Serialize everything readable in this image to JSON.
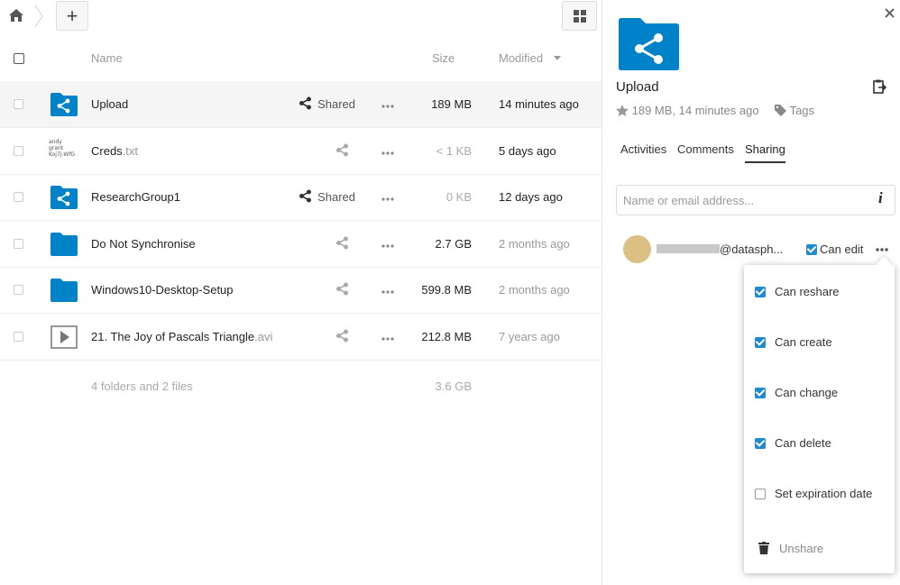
{
  "toolbar": {
    "new_label": "+"
  },
  "header": {
    "name": "Name",
    "size": "Size",
    "modified": "Modified"
  },
  "files": [
    {
      "name": "Upload",
      "ext": "",
      "type": "shared-folder",
      "share_label": "Shared",
      "size": "189 MB",
      "modified": "14 minutes ago",
      "selected": true,
      "size_color": "#222",
      "mod_color": "#222"
    },
    {
      "name": "Creds",
      "ext": ".txt",
      "type": "text",
      "thumb_text": "andy grant Koj7j-WfG",
      "share_label": "",
      "size": "< 1 KB",
      "modified": "5 days ago",
      "selected": false,
      "size_color": "#aaa",
      "mod_color": "#222"
    },
    {
      "name": "ResearchGroup1",
      "ext": "",
      "type": "shared-folder",
      "share_label": "Shared",
      "size": "0 KB",
      "modified": "12 days ago",
      "selected": false,
      "size_color": "#aaa",
      "mod_color": "#222"
    },
    {
      "name": "Do Not Synchronise",
      "ext": "",
      "type": "folder",
      "share_label": "",
      "size": "2.7 GB",
      "modified": "2 months ago",
      "selected": false,
      "size_color": "#222",
      "mod_color": "#999"
    },
    {
      "name": "Windows10-Desktop-Setup",
      "ext": "",
      "type": "folder",
      "share_label": "",
      "size": "599.8 MB",
      "modified": "2 months ago",
      "selected": false,
      "size_color": "#222",
      "mod_color": "#999"
    },
    {
      "name": "21. The Joy of Pascals Triangle",
      "ext": ".avi",
      "type": "video",
      "share_label": "",
      "size": "212.8 MB",
      "modified": "7 years ago",
      "selected": false,
      "size_color": "#222",
      "mod_color": "#999"
    }
  ],
  "summary": {
    "count": "4 folders and 2 files",
    "total": "3.6 GB"
  },
  "sidebar": {
    "title": "Upload",
    "meta": "189 MB, 14 minutes ago",
    "tags_label": "Tags",
    "tabs": [
      "Activities",
      "Comments",
      "Sharing"
    ],
    "active_tab": 2,
    "share_placeholder": "Name or email address...",
    "share_entry": {
      "email": "@datasph...",
      "permission_label": "Can edit"
    },
    "menu": {
      "items": [
        {
          "label": "Can reshare",
          "checked": true
        },
        {
          "label": "Can create",
          "checked": true
        },
        {
          "label": "Can change",
          "checked": true
        },
        {
          "label": "Can delete",
          "checked": true
        },
        {
          "label": "Set expiration date",
          "checked": false
        }
      ],
      "unshare_label": "Unshare"
    }
  },
  "colors": {
    "accent": "#0082c9",
    "checkbox": "#1f8ad0",
    "avatar": "#dbbf83"
  }
}
